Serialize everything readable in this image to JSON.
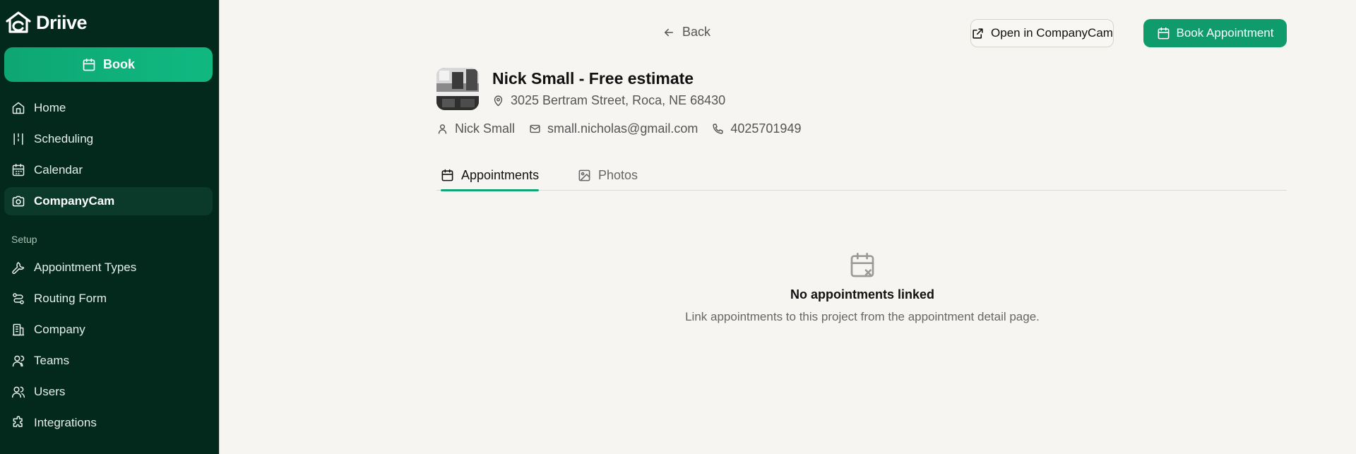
{
  "brand": {
    "name": "Driive"
  },
  "sidebar": {
    "book_label": "Book",
    "items": [
      {
        "label": "Home",
        "icon": "home-icon"
      },
      {
        "label": "Scheduling",
        "icon": "scheduling-icon"
      },
      {
        "label": "Calendar",
        "icon": "calendar-icon"
      },
      {
        "label": "CompanyCam",
        "icon": "camera-icon",
        "active": true
      }
    ],
    "setup_heading": "Setup",
    "setup_items": [
      {
        "label": "Appointment Types",
        "icon": "wrench-icon"
      },
      {
        "label": "Routing Form",
        "icon": "route-icon"
      },
      {
        "label": "Company",
        "icon": "building-icon"
      },
      {
        "label": "Teams",
        "icon": "user-icon"
      },
      {
        "label": "Users",
        "icon": "users-icon"
      },
      {
        "label": "Integrations",
        "icon": "puzzle-icon"
      }
    ]
  },
  "header": {
    "back_label": "Back",
    "open_label": "Open in CompanyCam",
    "book_label": "Book Appointment"
  },
  "project": {
    "title": "Nick Small - Free estimate",
    "address": "3025 Bertram Street, Roca, NE 68430",
    "contact_name": "Nick Small",
    "email": "small.nicholas@gmail.com",
    "phone": "4025701949"
  },
  "tabs": [
    {
      "label": "Appointments",
      "active": true
    },
    {
      "label": "Photos",
      "active": false
    }
  ],
  "empty_state": {
    "title": "No appointments linked",
    "description": "Link appointments to this project from the appointment detail page."
  },
  "colors": {
    "sidebar_bg": "#03291c",
    "accent": "#0f9b6c",
    "page_bg": "#f6f5f2"
  }
}
